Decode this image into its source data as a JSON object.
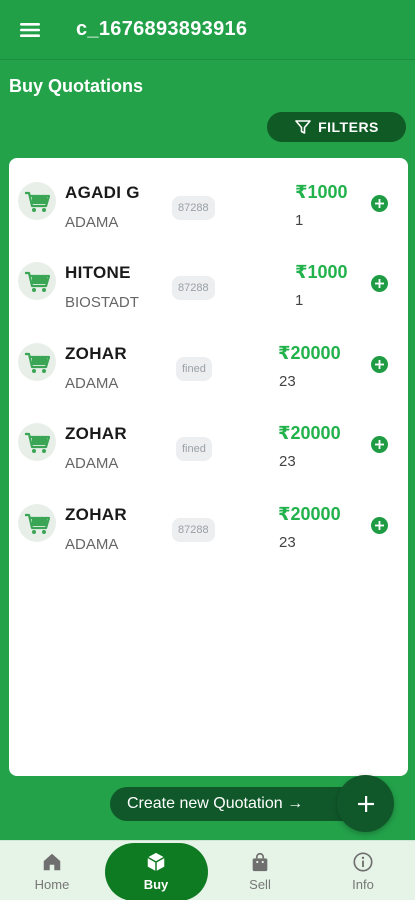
{
  "appbar": {
    "title": "c_1676893893916",
    "menu_icon": "hamburger-menu-icon"
  },
  "page": {
    "title": "Buy Quotations",
    "filters_label": "FILTERS",
    "filter_icon": "filter-funnel-icon"
  },
  "colors": {
    "primary": "#22a048",
    "dark": "#10582a",
    "price": "#22b24c",
    "nav_active": "#0e7a22"
  },
  "quotations": [
    {
      "product": "AGADI G",
      "company": "ADAMA",
      "tag": "87288",
      "price": "₹1000",
      "quantity": "1"
    },
    {
      "product": "HITONE",
      "company": "BIOSTADT",
      "tag": "87288",
      "price": "₹1000",
      "quantity": "1"
    },
    {
      "product": "ZOHAR",
      "company": "ADAMA",
      "tag": "fined",
      "price": "₹20000",
      "quantity": "23"
    },
    {
      "product": "ZOHAR",
      "company": "ADAMA",
      "tag": "fined",
      "price": "₹20000",
      "quantity": "23"
    },
    {
      "product": "ZOHAR",
      "company": "ADAMA",
      "tag": "87288",
      "price": "₹20000",
      "quantity": "23"
    }
  ],
  "actions": {
    "create_label": "Create new Quotation →",
    "fab_icon": "plus-icon"
  },
  "bottom_nav": {
    "items": [
      {
        "label": "Home",
        "icon": "home-icon"
      },
      {
        "label": "Buy",
        "icon": "box-icon"
      },
      {
        "label": "Sell",
        "icon": "shopping-bag-icon"
      },
      {
        "label": "Info",
        "icon": "info-icon"
      }
    ],
    "active": "Buy"
  }
}
